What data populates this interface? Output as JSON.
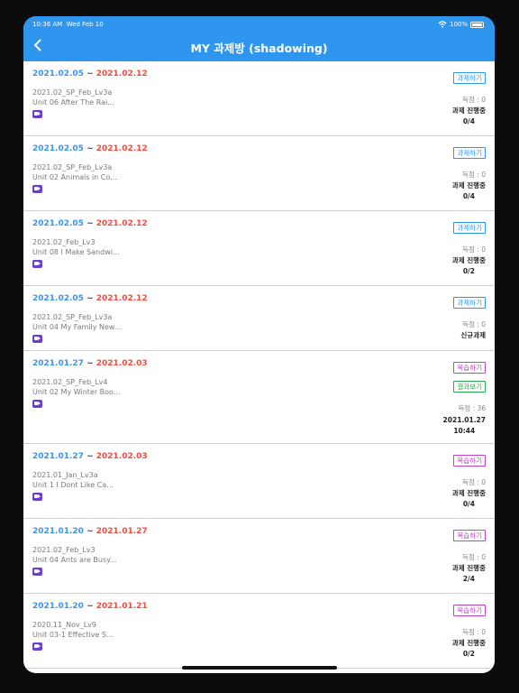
{
  "status_bar": {
    "time": "10:36 AM",
    "date": "Wed Feb 10",
    "battery": "100%"
  },
  "header": {
    "title": "MY 과제방 (shadowing)"
  },
  "icons": {
    "back": "chevron-left-icon",
    "video": "video-icon",
    "wifi": "wifi-icon",
    "battery": "battery-icon"
  },
  "colors": {
    "header_bg": "#2f96f0",
    "start_date": "#3b95e9",
    "end_date": "#ef4d40",
    "do_btn": "#2f96f0",
    "review_btn": "#c045c8",
    "result_btn": "#2faa4e"
  },
  "items": [
    {
      "start": "2021.02.05",
      "end": "2021.02.12",
      "course": "2021.02_SP_Feb_Lv3a",
      "unit": "Unit 06 After The Rai...",
      "button": "과제하기",
      "score": "득점 : 0",
      "status": "과제 진행중",
      "progress": "0/4"
    },
    {
      "start": "2021.02.05",
      "end": "2021.02.12",
      "course": "2021.02_SP_Feb_Lv3a",
      "unit": "Unit 02 Animals in Co...",
      "button": "과제하기",
      "score": "득점 : 0",
      "status": "과제 진행중",
      "progress": "0/4"
    },
    {
      "start": "2021.02.05",
      "end": "2021.02.12",
      "course": "2021.02_Feb_Lv3",
      "unit": "Unit 08 I Make Sandwi...",
      "button": "과제하기",
      "score": "득점 : 0",
      "status": "과제 진행중",
      "progress": "0/2"
    },
    {
      "start": "2021.02.05",
      "end": "2021.02.12",
      "course": "2021.02_SP_Feb_Lv3a",
      "unit": "Unit 04 My Family New...",
      "button": "과제하기",
      "score": "득점 : 0",
      "status": "신규과제",
      "progress": ""
    },
    {
      "start": "2021.01.27",
      "end": "2021.02.03",
      "course": "2021.02_SP_Feb_Lv4",
      "unit": "Unit 02 My Winter Boo...",
      "button": "복습하기",
      "button2": "결과보기",
      "score": "득점 : 36",
      "status": "2021.01.27",
      "progress": "10:44"
    },
    {
      "start": "2021.01.27",
      "end": "2021.02.03",
      "course": "2021.01_Jan_Lv3a",
      "unit": "Unit 1 I Dont Like Ca...",
      "button": "복습하기",
      "score": "득점 : 0",
      "status": "과제 진행중",
      "progress": "0/4"
    },
    {
      "start": "2021.01.20",
      "end": "2021.01.27",
      "course": "2021.02_Feb_Lv3",
      "unit": "Unit 04 Ants are Busy...",
      "button": "복습하기",
      "score": "득점 : 0",
      "status": "과제 진행중",
      "progress": "2/4"
    },
    {
      "start": "2021.01.20",
      "end": "2021.01.21",
      "course": "2020.11_Nov_Lv9",
      "unit": "Unit 03-1 Effective S...",
      "button": "복습하기",
      "score": "득점 : 0",
      "status": "과제 진행중",
      "progress": "0/2"
    }
  ]
}
